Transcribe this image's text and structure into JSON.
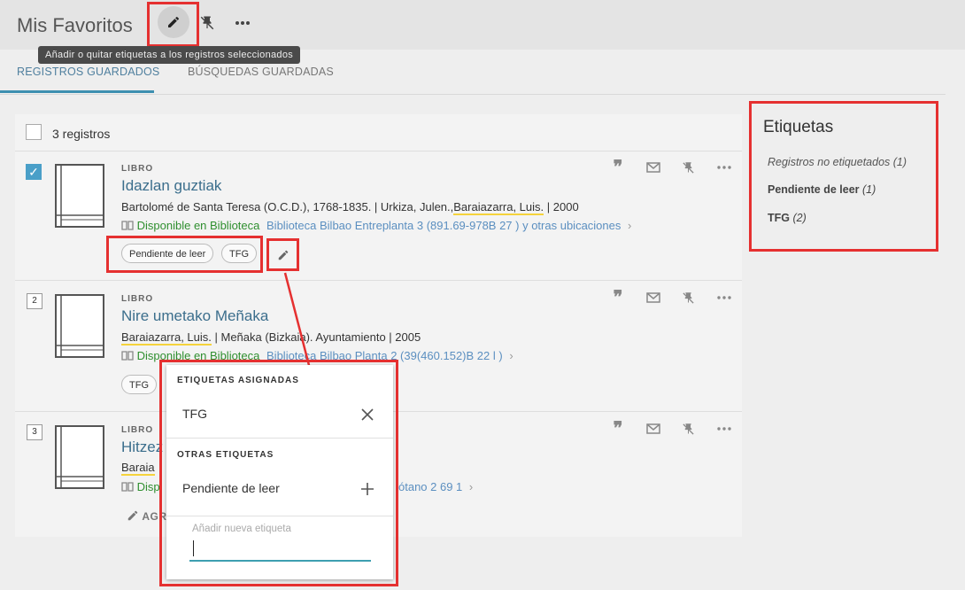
{
  "header": {
    "title": "Mis Favoritos",
    "tooltip": "Añadir o quitar etiquetas a los registros seleccionados"
  },
  "tabs": [
    {
      "label": "REGISTROS GUARDADOS",
      "active": true
    },
    {
      "label": "BÚSQUEDAS GUARDADAS",
      "active": false
    }
  ],
  "list": {
    "count_label": "3 registros"
  },
  "records": [
    {
      "index": "1",
      "checked": true,
      "type": "LIBRO",
      "title": "Idazlan guztiak",
      "meta_a": "Bartolomé de Santa Teresa (O.C.D.), 1768-1835. | Urkiza, Julen.,",
      "meta_b": "Baraiazarra, Luis.",
      "meta_c": " | 2000",
      "availability": "Disponible en Biblioteca",
      "location": "Biblioteca Bilbao Entreplanta 3 (891.69-978B 27 ) y otras ubicaciones",
      "tags": [
        "Pendiente de leer",
        "TFG"
      ]
    },
    {
      "index": "2",
      "checked": false,
      "type": "LIBRO",
      "title": "Nire umetako Meñaka",
      "meta_a": "",
      "meta_b": "Baraiazarra, Luis.",
      "meta_c": " | Meñaka (Bizkaia). Ayuntamiento | 2005",
      "availability": "Disponible en Biblioteca",
      "location": "Biblioteca Bilbao Planta 2 (39(460.152)B 22 l )",
      "tags": [
        "TFG"
      ]
    },
    {
      "index": "3",
      "checked": false,
      "type": "LIBRO",
      "title": "Hitzez",
      "meta_b": "Baraia",
      "availability": "Disp",
      "location": "ótano 2 69 1",
      "add_label": "AGR"
    }
  ],
  "sidebar": {
    "title": "Etiquetas",
    "items": [
      {
        "label": "Registros no etiquetados",
        "count": "(1)",
        "italic": true
      },
      {
        "label": "Pendiente de leer",
        "count": "(1)",
        "italic": false
      },
      {
        "label": "TFG",
        "count": "(2)",
        "italic": false
      }
    ]
  },
  "popup": {
    "assigned_title": "ETIQUETAS ASIGNADAS",
    "assigned": [
      "TFG"
    ],
    "other_title": "OTRAS ETIQUETAS",
    "others": [
      "Pendiente de leer"
    ],
    "new_tag_placeholder": "Añadir nueva etiqueta"
  },
  "colors": {
    "highlight": "#e53030",
    "accent": "#3d8fb0",
    "available": "#2f8f2f",
    "link": "#5b8fc0"
  }
}
